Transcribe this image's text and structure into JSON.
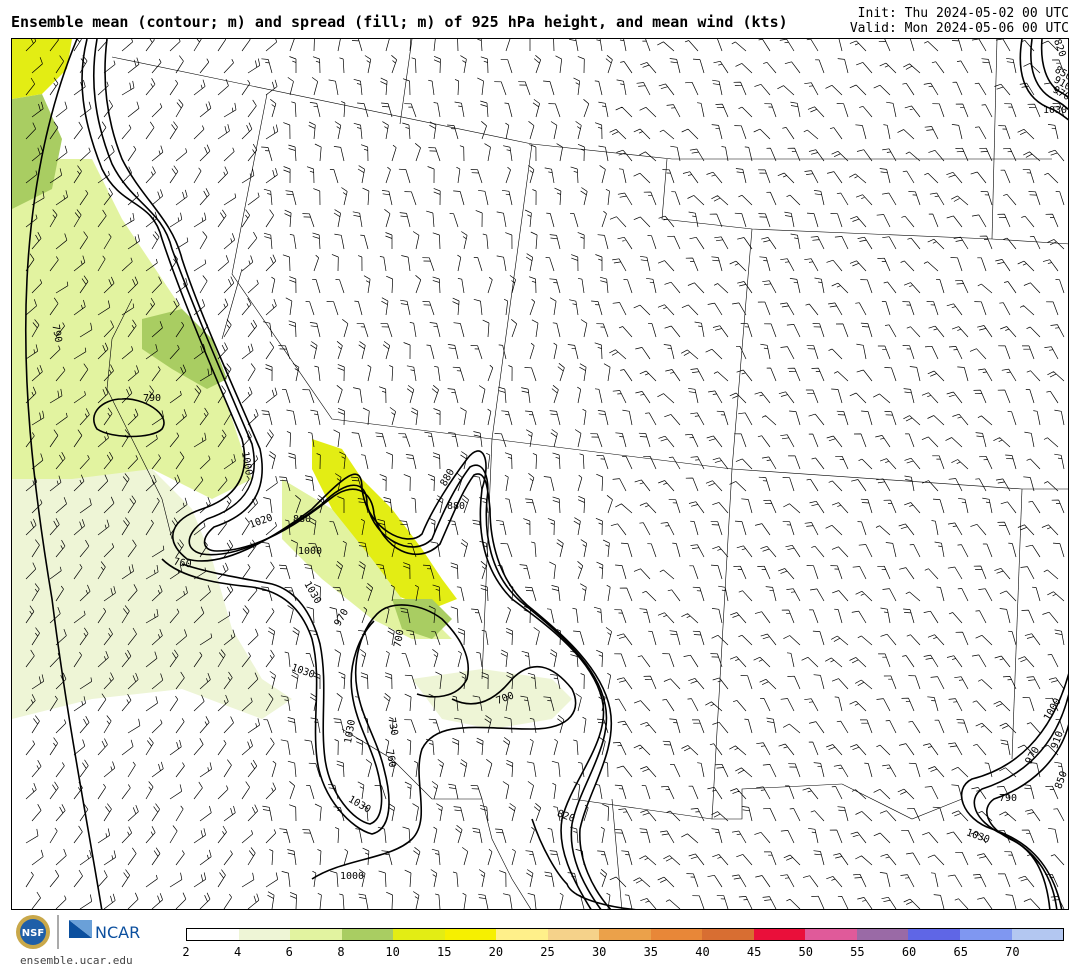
{
  "title": "Ensemble mean (contour; m) and spread (fill; m) of 925 hPa height, and mean wind (kts)",
  "init": "Init: Thu 2024-05-02 00 UTC",
  "valid": "Valid: Mon 2024-05-06 00 UTC",
  "site": "ensemble.ucar.edu",
  "logos": {
    "nsf": "NSF",
    "ncar": "NCAR"
  },
  "colorbar": {
    "ticks": [
      "2",
      "4",
      "6",
      "8",
      "10",
      "15",
      "20",
      "25",
      "30",
      "35",
      "40",
      "45",
      "50",
      "55",
      "60",
      "65",
      "70"
    ],
    "colors": [
      "#ffffff",
      "#eef5d6",
      "#e2f3a0",
      "#a9cd62",
      "#e3ed14",
      "#f6f000",
      "#fff08a",
      "#f5d28a",
      "#eba14a",
      "#e88738",
      "#d86e32",
      "#ea0f3a",
      "#e05a9a",
      "#9a6aa6",
      "#5f66e6",
      "#7f97f1",
      "#b3c7f1"
    ]
  },
  "contour_labels": [
    {
      "t": "790",
      "a": 80
    },
    {
      "t": "790",
      "a": 0
    },
    {
      "t": "1000",
      "a": 80
    },
    {
      "t": "1020",
      "a": -20
    },
    {
      "t": "880",
      "a": 0
    },
    {
      "t": "1000",
      "a": 0
    },
    {
      "t": "760",
      "a": 10
    },
    {
      "t": "1030",
      "a": 60
    },
    {
      "t": "970",
      "a": -60
    },
    {
      "t": "700",
      "a": -80
    },
    {
      "t": "700",
      "a": -20
    },
    {
      "t": "730",
      "a": 80
    },
    {
      "t": "760",
      "a": 80
    },
    {
      "t": "1030",
      "a": -80
    },
    {
      "t": "1030",
      "a": 30
    },
    {
      "t": "880",
      "a": -60
    },
    {
      "t": "880",
      "a": 0
    },
    {
      "t": "820",
      "a": 20
    },
    {
      "t": "1030",
      "a": 20
    },
    {
      "t": "1000",
      "a": -60
    },
    {
      "t": "910",
      "a": -70
    },
    {
      "t": "850",
      "a": -70
    },
    {
      "t": "970",
      "a": -60
    },
    {
      "t": "1030",
      "a": 0
    },
    {
      "t": "970",
      "a": 30
    },
    {
      "t": "910",
      "a": 30
    },
    {
      "t": "850",
      "a": 30
    },
    {
      "t": "820",
      "a": 70
    },
    {
      "t": "1030",
      "a": 20
    },
    {
      "t": "1000",
      "a": 0
    },
    {
      "t": "790",
      "a": 0
    }
  ]
}
